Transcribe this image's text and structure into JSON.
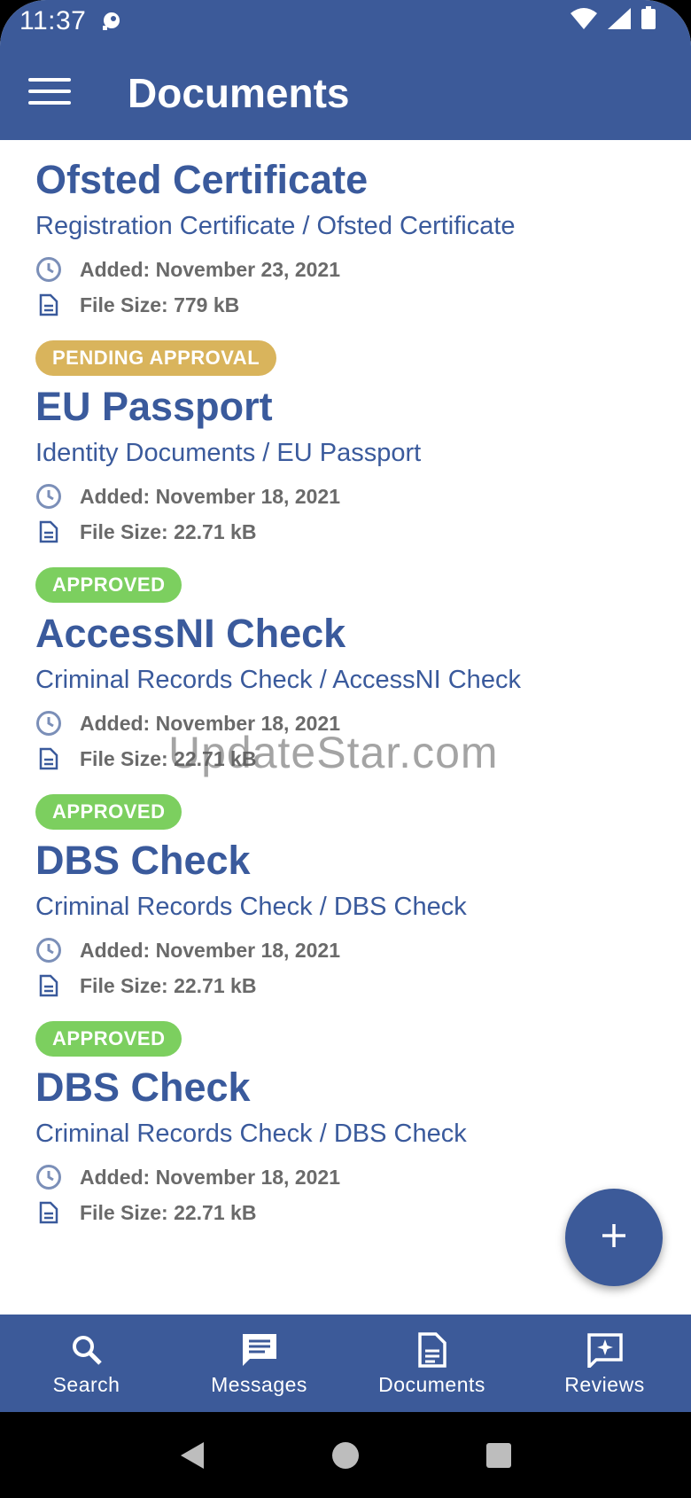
{
  "status_bar": {
    "time": "11:37"
  },
  "app_bar": {
    "title": "Documents"
  },
  "documents": [
    {
      "title": "Ofsted Certificate",
      "path": "Registration Certificate / Ofsted Certificate",
      "added": "Added: November 23, 2021",
      "size": "File Size: 779 kB",
      "status": "PENDING APPROVAL",
      "status_color": "#d9b45c"
    },
    {
      "title": "EU Passport",
      "path": "Identity Documents / EU Passport",
      "added": "Added: November 18, 2021",
      "size": "File Size: 22.71 kB",
      "status": "APPROVED",
      "status_color": "#7ccf5f"
    },
    {
      "title": "AccessNI Check",
      "path": "Criminal Records Check / AccessNI Check",
      "added": "Added: November 18, 2021",
      "size": "File Size: 22.71 kB",
      "status": "APPROVED",
      "status_color": "#7ccf5f"
    },
    {
      "title": "DBS Check",
      "path": "Criminal Records Check / DBS Check",
      "added": "Added: November 18, 2021",
      "size": "File Size: 22.71 kB",
      "status": "APPROVED",
      "status_color": "#7ccf5f"
    },
    {
      "title": "DBS Check",
      "path": "Criminal Records Check / DBS Check",
      "added": "Added: November 18, 2021",
      "size": "File Size: 22.71 kB"
    }
  ],
  "watermark": "UpdateStar.com",
  "fab": {
    "icon": "plus-icon"
  },
  "bottom_nav": [
    {
      "label": "Search",
      "icon": "search-icon"
    },
    {
      "label": "Messages",
      "icon": "message-icon"
    },
    {
      "label": "Documents",
      "icon": "document-icon"
    },
    {
      "label": "Reviews",
      "icon": "review-icon"
    }
  ],
  "colors": {
    "primary": "#3c5a99",
    "accent_text": "#3a5a9c",
    "pending": "#d9b45c",
    "approved": "#7ccf5f"
  }
}
